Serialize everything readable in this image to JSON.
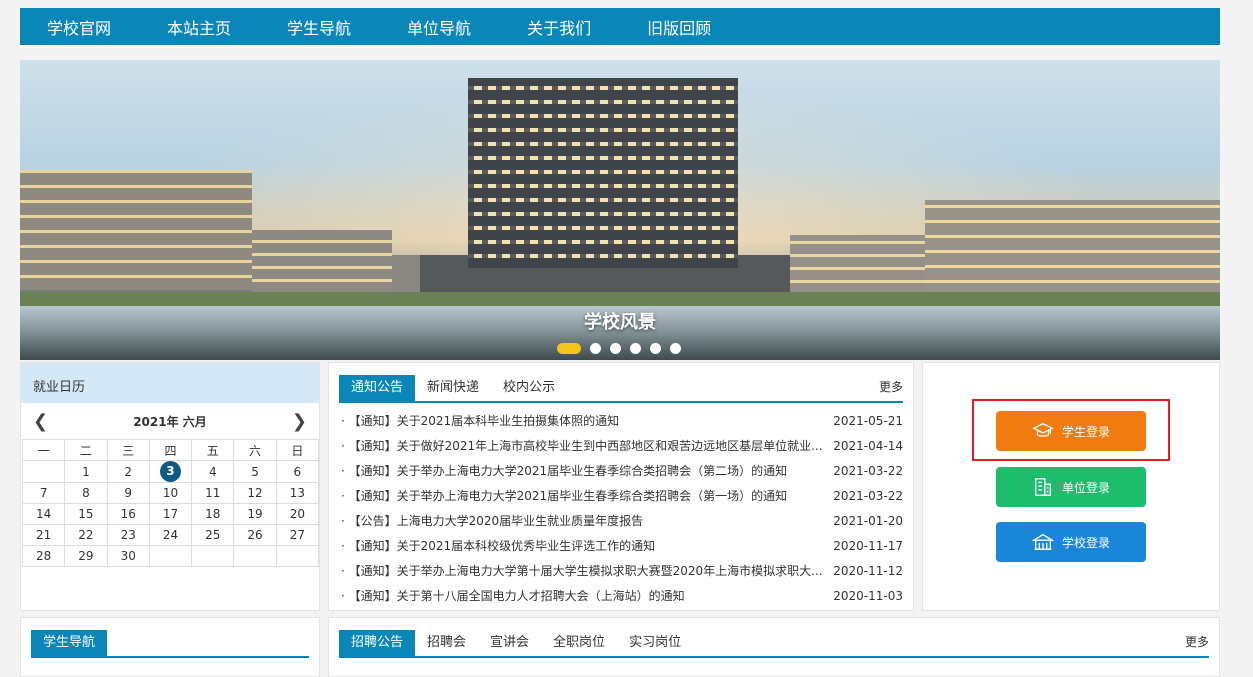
{
  "nav": [
    "学校官网",
    "本站主页",
    "学生导航",
    "单位导航",
    "关于我们",
    "旧版回顾"
  ],
  "banner": {
    "caption": "学校风景",
    "slide_count": 6,
    "active_slide": 1
  },
  "calendar": {
    "title": "就业日历",
    "month_label": "2021年 六月",
    "weekdays": [
      "一",
      "二",
      "三",
      "四",
      "五",
      "六",
      "日"
    ],
    "weeks": [
      [
        "",
        "1",
        "2",
        "3",
        "4",
        "5",
        "6"
      ],
      [
        "7",
        "8",
        "9",
        "10",
        "11",
        "12",
        "13"
      ],
      [
        "14",
        "15",
        "16",
        "17",
        "18",
        "19",
        "20"
      ],
      [
        "21",
        "22",
        "23",
        "24",
        "25",
        "26",
        "27"
      ],
      [
        "28",
        "29",
        "30",
        "",
        "",
        "",
        ""
      ]
    ],
    "today": "3"
  },
  "news": {
    "tabs": [
      "通知公告",
      "新闻快递",
      "校内公示"
    ],
    "more": "更多",
    "items": [
      {
        "title": "· 【通知】关于2021届本科毕业生拍摄集体照的通知",
        "date": "2021-05-21"
      },
      {
        "title": "· 【通知】关于做好2021年上海市高校毕业生到中西部地区和艰苦边远地区基层单位就业...",
        "date": "2021-04-14"
      },
      {
        "title": "· 【通知】关于举办上海电力大学2021届毕业生春季综合类招聘会（第二场）的通知",
        "date": "2021-03-22"
      },
      {
        "title": "· 【通知】关于举办上海电力大学2021届毕业生春季综合类招聘会（第一场）的通知",
        "date": "2021-03-22"
      },
      {
        "title": "· 【公告】上海电力大学2020届毕业生就业质量年度报告",
        "date": "2021-01-20"
      },
      {
        "title": "· 【通知】关于2021届本科校级优秀毕业生评选工作的通知",
        "date": "2020-11-17"
      },
      {
        "title": "· 【通知】关于举办上海电力大学第十届大学生模拟求职大赛暨2020年上海市模拟求职大...",
        "date": "2020-11-12"
      },
      {
        "title": "· 【通知】关于第十八届全国电力人才招聘大会（上海站）的通知",
        "date": "2020-11-03"
      }
    ]
  },
  "login": {
    "student": "学生登录",
    "unit": "单位登录",
    "school": "学校登录"
  },
  "student_nav": {
    "tab": "学生导航"
  },
  "recruit": {
    "tabs": [
      "招聘公告",
      "招聘会",
      "宣讲会",
      "全职岗位",
      "实习岗位"
    ],
    "more": "更多"
  },
  "colors": {
    "primary": "#0b86b8",
    "calendar_header": "#d4e8f8",
    "student_btn": "#f07c10",
    "unit_btn": "#1dbd6e",
    "school_btn": "#1a86d8",
    "highlight_box": "#e02020",
    "active_dot": "#f5c518"
  },
  "icons": {
    "student": "graduation-cap-icon",
    "unit": "building-icon",
    "school": "school-icon"
  }
}
